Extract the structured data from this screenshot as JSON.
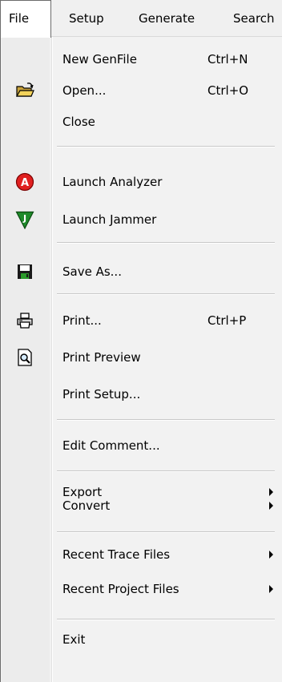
{
  "menubar": {
    "items": [
      {
        "label": "File"
      },
      {
        "label": "Setup"
      },
      {
        "label": "Generate"
      },
      {
        "label": "Search"
      }
    ]
  },
  "menu": {
    "new_genfile": {
      "label": "New GenFile",
      "shortcut": "Ctrl+N"
    },
    "open": {
      "label": "Open...",
      "shortcut": "Ctrl+O",
      "icon": "open-folder-icon"
    },
    "close": {
      "label": "Close"
    },
    "launch_analyzer": {
      "label": "Launch Analyzer",
      "icon": "analyzer-icon",
      "icon_letter": "A",
      "icon_color": "#e02020"
    },
    "launch_jammer": {
      "label": "Launch Jammer",
      "icon": "jammer-icon",
      "icon_letter": "J",
      "icon_color": "#1e8a2a"
    },
    "save_as": {
      "label": "Save As...",
      "icon": "floppy-disk-icon"
    },
    "print": {
      "label": "Print...",
      "shortcut": "Ctrl+P",
      "icon": "printer-icon"
    },
    "print_preview": {
      "label": "Print Preview",
      "icon": "print-preview-icon"
    },
    "print_setup": {
      "label": "Print Setup..."
    },
    "edit_comment": {
      "label": "Edit Comment..."
    },
    "export": {
      "label": "Export"
    },
    "convert": {
      "label": "Convert"
    },
    "recent_trace": {
      "label": "Recent Trace Files"
    },
    "recent_project": {
      "label": "Recent Project Files"
    },
    "exit": {
      "label": "Exit"
    }
  }
}
